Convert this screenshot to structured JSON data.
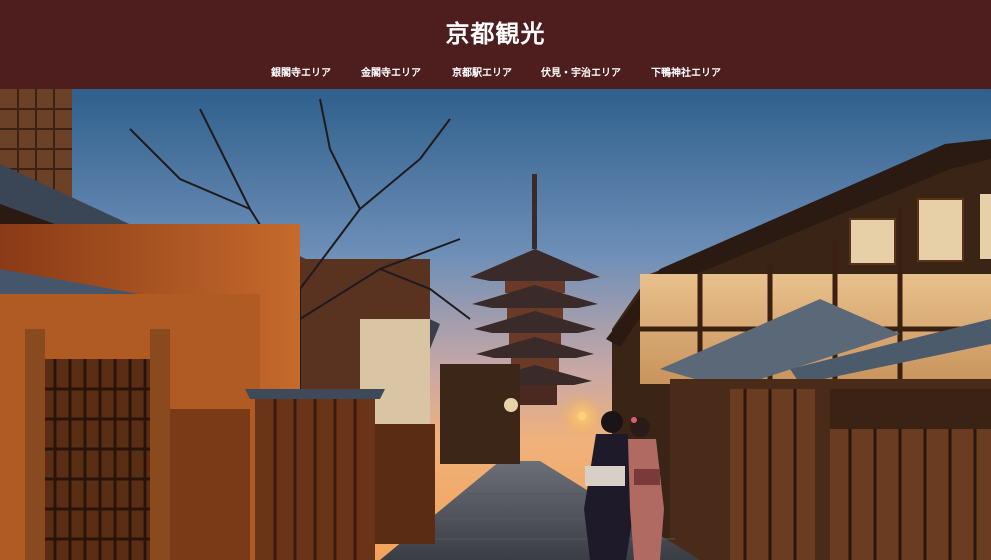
{
  "site": {
    "title": "京都観光"
  },
  "nav": {
    "items": [
      {
        "label": "銀閣寺エリア"
      },
      {
        "label": "金閣寺エリア"
      },
      {
        "label": "京都駅エリア"
      },
      {
        "label": "伏見・宇治エリア"
      },
      {
        "label": "下鴨神社エリア"
      }
    ]
  },
  "colors": {
    "header_bg": "#4e1e1f",
    "header_text": "#ffffff"
  },
  "hero": {
    "image": "kyoto-yasaka-pagoda-street-dusk"
  }
}
